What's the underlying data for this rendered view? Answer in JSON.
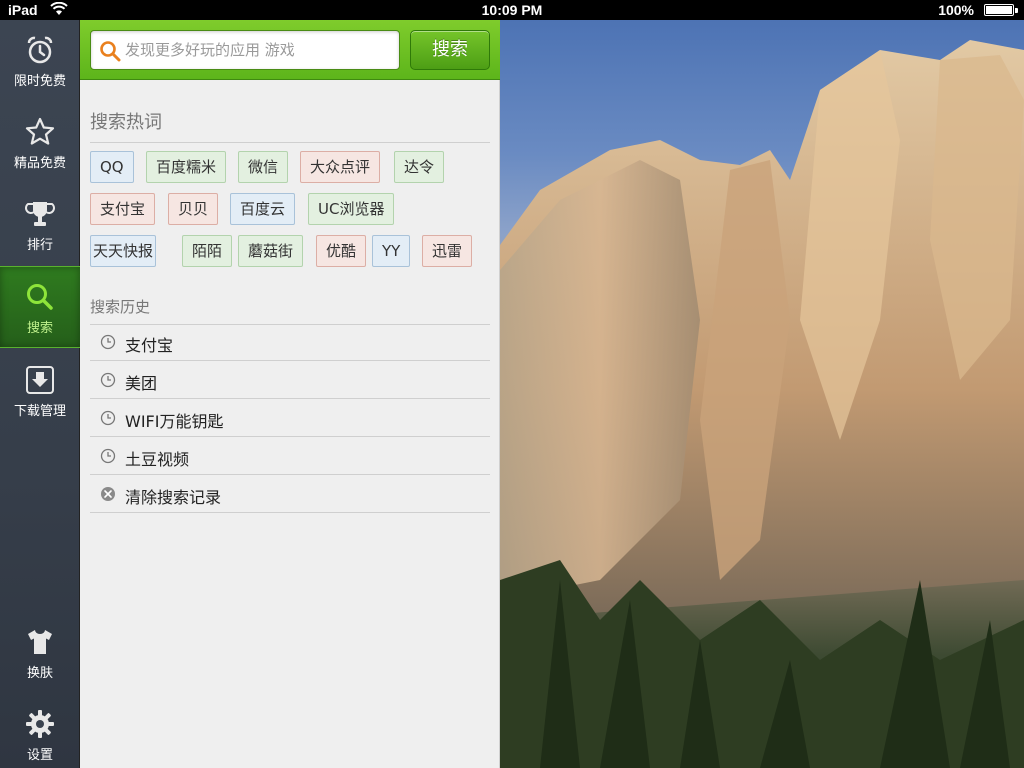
{
  "status_bar": {
    "device": "iPad",
    "time": "10:09 PM",
    "battery": "100%"
  },
  "sidebar": {
    "items": [
      {
        "label": "限时免费",
        "icon": "alarm-clock-icon"
      },
      {
        "label": "精品免费",
        "icon": "star-icon"
      },
      {
        "label": "排行",
        "icon": "trophy-icon"
      },
      {
        "label": "搜索",
        "icon": "search-icon",
        "active": true
      },
      {
        "label": "下载管理",
        "icon": "download-icon"
      }
    ],
    "bottom_items": [
      {
        "label": "换肤",
        "icon": "tshirt-icon"
      },
      {
        "label": "设置",
        "icon": "gear-icon"
      }
    ]
  },
  "search": {
    "placeholder": "发现更多好玩的应用 游戏",
    "button_label": "搜索"
  },
  "hot_keywords": {
    "title": "搜索热词",
    "rows": [
      [
        {
          "text": "QQ",
          "color": "blue"
        },
        {
          "text": "百度糯米",
          "color": "green"
        },
        {
          "text": "微信",
          "color": "green"
        },
        {
          "text": "大众点评",
          "color": "red"
        },
        {
          "text": "达令",
          "color": "green"
        }
      ],
      [
        {
          "text": "支付宝",
          "color": "red"
        },
        {
          "text": "贝贝",
          "color": "red"
        },
        {
          "text": "百度云",
          "color": "blue"
        },
        {
          "text": "UC浏览器",
          "color": "green"
        }
      ],
      [
        {
          "text": "天天快报",
          "color": "blue"
        },
        {
          "text": "陌陌",
          "color": "green"
        },
        {
          "text": "蘑菇街",
          "color": "green"
        },
        {
          "text": "优酷",
          "color": "red"
        },
        {
          "text": "YY",
          "color": "blue"
        },
        {
          "text": "迅雷",
          "color": "red"
        }
      ]
    ]
  },
  "history": {
    "title": "搜索历史",
    "items": [
      "支付宝",
      "美团",
      "WIFI万能钥匙",
      "土豆视频"
    ],
    "clear_label": "清除搜索记录"
  },
  "colors": {
    "accent_green": "#5db51b",
    "sidebar_bg": "#3c4552",
    "panel_bg": "#efefef"
  }
}
